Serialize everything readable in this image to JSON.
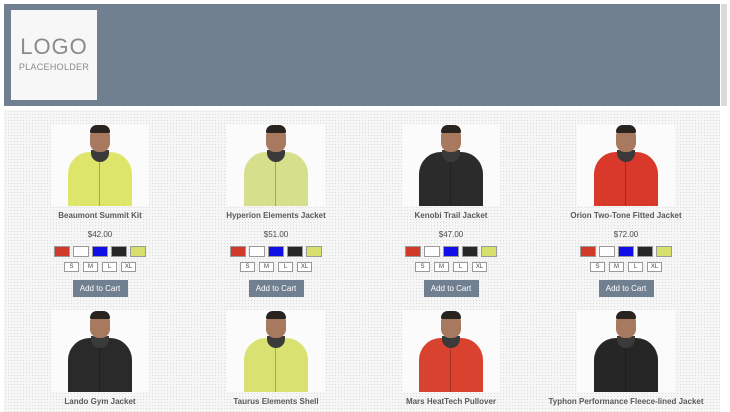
{
  "header": {
    "logo_main": "LOGO",
    "logo_sub": "PLACEHOLDER",
    "bg_color": "#718090"
  },
  "swatch_colors": [
    "#d03a2a",
    "#ffffff",
    "#1010e6",
    "#262626",
    "#d7e06a"
  ],
  "sizes": [
    "S",
    "M",
    "L",
    "XL"
  ],
  "add_label": "Add to Cart",
  "products": [
    {
      "name": "Beaumont Summit Kit",
      "price": "$42.00",
      "shirt_color": "#dde66a"
    },
    {
      "name": "Hyperion Elements Jacket",
      "price": "$51.00",
      "shirt_color": "#d6e08c"
    },
    {
      "name": "Kenobi Trail Jacket",
      "price": "$47.00",
      "shirt_color": "#2b2b2b"
    },
    {
      "name": "Orion Two-Tone Fitted Jacket",
      "price": "$72.00",
      "shirt_color": "#d8392a"
    },
    {
      "name": "Lando Gym Jacket",
      "shirt_color": "#2a2a2a"
    },
    {
      "name": "Taurus Elements Shell",
      "shirt_color": "#d9e270"
    },
    {
      "name": "Mars HeatTech Pullover",
      "shirt_color": "#d9422f"
    },
    {
      "name": "Typhon Performance Fleece-lined Jacket",
      "shirt_color": "#262626"
    }
  ]
}
